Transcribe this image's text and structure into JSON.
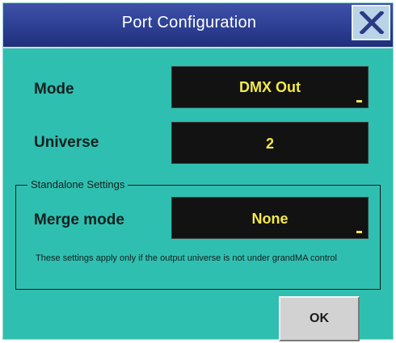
{
  "dialog": {
    "title": "Port Configuration",
    "close_icon": "close-icon"
  },
  "mode": {
    "label": "Mode",
    "value": "DMX Out"
  },
  "universe": {
    "label": "Universe",
    "value": "2"
  },
  "standalone": {
    "group_title": "Standalone Settings",
    "merge_label": "Merge mode",
    "merge_value": "None",
    "note": "These settings apply only if the output universe is not under grandMA control"
  },
  "buttons": {
    "ok_label": "OK"
  },
  "colors": {
    "background": "#2fbfb0",
    "titlebar": "#2d3f93",
    "field_background": "#121212",
    "field_text": "#f3e94a"
  }
}
